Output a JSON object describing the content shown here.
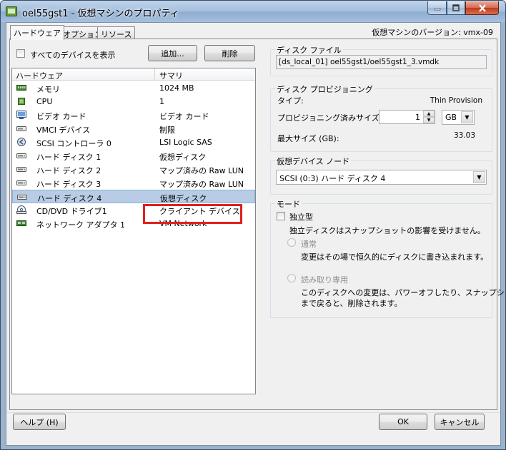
{
  "window": {
    "title": "oel55gst1 - 仮想マシンのプロパティ",
    "vm_version": "仮想マシンのバージョン: vmx-09"
  },
  "tabs": [
    {
      "label": "ハードウェア",
      "active": true
    },
    {
      "label": "オプション",
      "active": false
    },
    {
      "label": "リソース",
      "active": false
    }
  ],
  "hardware": {
    "show_all_label": "すべてのデバイスを表示",
    "show_all_checked": false,
    "add_label": "追加...",
    "remove_label": "削除",
    "col_hardware": "ハードウェア",
    "col_summary": "サマリ",
    "rows": [
      {
        "icon": "memory-icon",
        "name": "メモリ",
        "summary": "1024 MB"
      },
      {
        "icon": "cpu-icon",
        "name": "CPU",
        "summary": "1"
      },
      {
        "icon": "video-card-icon",
        "name": "ビデオ カード",
        "summary": "ビデオ カード"
      },
      {
        "icon": "vmci-device-icon",
        "name": "VMCI デバイス",
        "summary": "制限"
      },
      {
        "icon": "scsi-controller-icon",
        "name": "SCSI コントローラ 0",
        "summary": "LSI Logic SAS"
      },
      {
        "icon": "hard-disk-icon",
        "name": "ハード ディスク 1",
        "summary": "仮想ディスク"
      },
      {
        "icon": "hard-disk-icon",
        "name": "ハード ディスク 2",
        "summary": "マップ済みの Raw LUN"
      },
      {
        "icon": "hard-disk-icon",
        "name": "ハード ディスク 3",
        "summary": "マップ済みの Raw LUN"
      },
      {
        "icon": "hard-disk-icon",
        "name": "ハード ディスク 4",
        "summary": "仮想ディスク",
        "selected": true
      },
      {
        "icon": "cd-dvd-drive-icon",
        "name": "CD/DVD ドライブ1",
        "summary": "クライアント デバイス"
      },
      {
        "icon": "network-adapter-icon",
        "name": "ネットワーク アダプタ 1",
        "summary": "VM Network"
      }
    ]
  },
  "disk_file": {
    "title": "ディスク ファイル",
    "path": "[ds_local_01] oel55gst1/oel55gst1_3.vmdk"
  },
  "provisioning": {
    "title": "ディスク プロビジョニング",
    "type_label": "タイプ:",
    "type_value": "Thin Provision",
    "size_label": "プロビジョニング済みサイズ:",
    "size_value": "1",
    "size_unit": "GB",
    "max_label": "最大サイズ (GB):",
    "max_value": "33.03"
  },
  "virtual_device_node": {
    "title": "仮想デバイス ノード",
    "value": "SCSI (0:3) ハード ディスク 4"
  },
  "mode": {
    "title": "モード",
    "independent_label": "独立型",
    "independent_checked": false,
    "independent_desc": "独立ディスクはスナップショットの影響を受けません。",
    "normal_label": "通常",
    "normal_desc": "変更はその場で恒久的にディスクに書き込まれます。",
    "readonly_label": "読み取り専用",
    "readonly_desc_1": "このディスクへの変更は、パワーオフしたり、スナップショット",
    "readonly_desc_2": "まで戻ると、削除されます。"
  },
  "footer": {
    "help_label": "ヘルプ (H)",
    "ok_label": "OK",
    "cancel_label": "キャンセル"
  }
}
